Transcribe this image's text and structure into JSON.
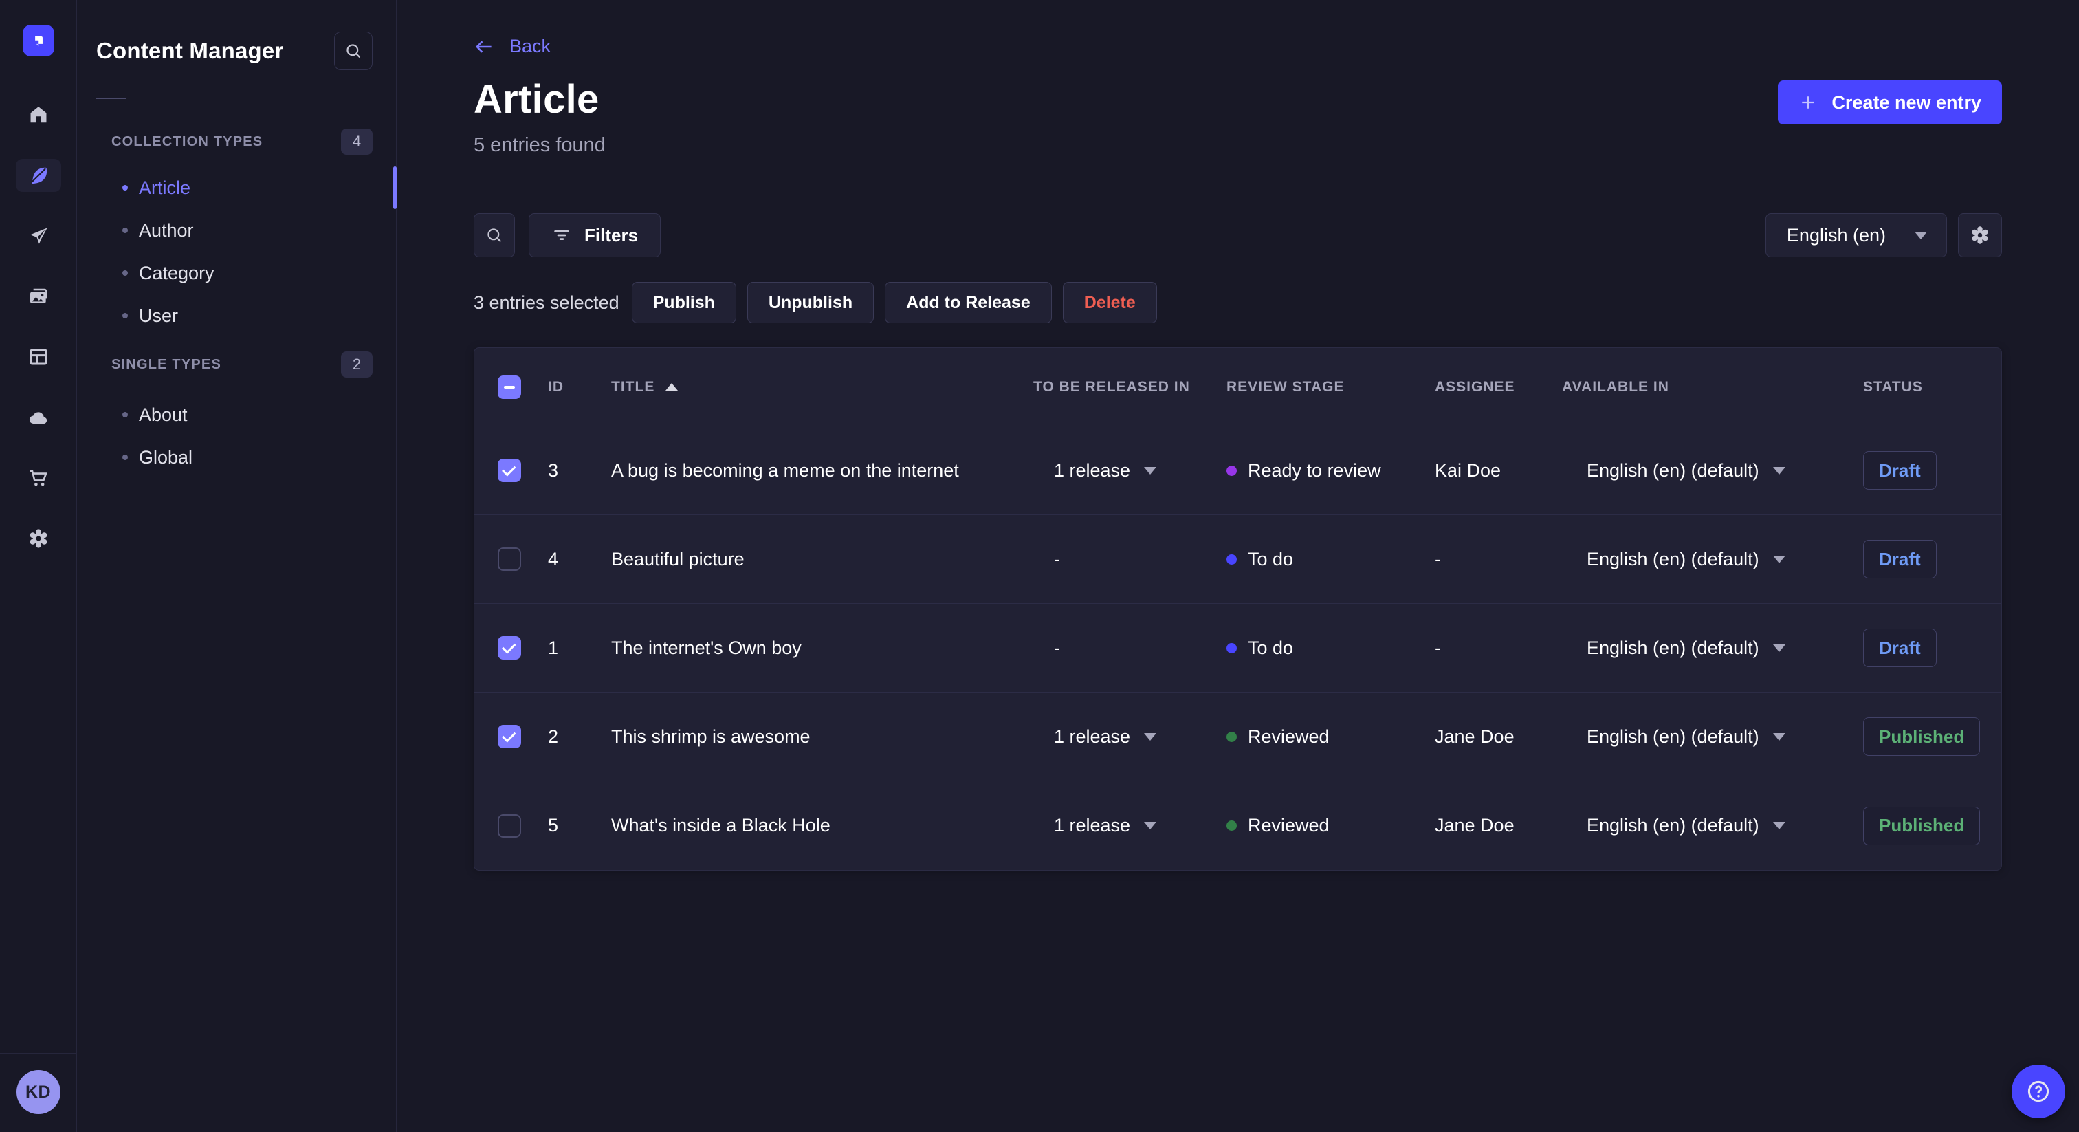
{
  "colors": {
    "brand": "#4945ff",
    "accent": "#7b79ff",
    "danger": "#ee5e52",
    "success": "#5cb176",
    "draft_blue": "#6f9bf5"
  },
  "rail": {
    "logo_icon": "strapi-logo",
    "items": [
      {
        "icon": "home-icon",
        "active": false
      },
      {
        "icon": "feather-icon",
        "active": true
      },
      {
        "icon": "paper-plane-icon",
        "active": false
      },
      {
        "icon": "media-library-icon",
        "active": false
      },
      {
        "icon": "layout-icon",
        "active": false
      },
      {
        "icon": "cloud-icon",
        "active": false
      },
      {
        "icon": "cart-icon",
        "active": false
      },
      {
        "icon": "gear-icon",
        "active": false
      }
    ],
    "avatar_initials": "KD"
  },
  "sidebar": {
    "title": "Content Manager",
    "search_icon": "search-icon",
    "sections": [
      {
        "label": "COLLECTION TYPES",
        "count": "4",
        "items": [
          {
            "label": "Article",
            "active": true
          },
          {
            "label": "Author",
            "active": false
          },
          {
            "label": "Category",
            "active": false
          },
          {
            "label": "User",
            "active": false
          }
        ]
      },
      {
        "label": "SINGLE TYPES",
        "count": "2",
        "items": [
          {
            "label": "About",
            "active": false
          },
          {
            "label": "Global",
            "active": false
          }
        ]
      }
    ]
  },
  "header": {
    "back_label": "Back",
    "title": "Article",
    "subtitle": "5 entries found",
    "create_button_label": "Create new entry"
  },
  "toolbar": {
    "filters_label": "Filters",
    "locale_value": "English (en)"
  },
  "selection": {
    "summary": "3 entries selected",
    "publish_label": "Publish",
    "unpublish_label": "Unpublish",
    "add_to_release_label": "Add to Release",
    "delete_label": "Delete"
  },
  "table": {
    "header_checkbox_indeterminate": true,
    "sort_column": "TITLE",
    "sort_direction": "asc",
    "headers": {
      "id": "ID",
      "title": "TITLE",
      "release": "TO BE RELEASED IN",
      "stage": "REVIEW STAGE",
      "assignee": "ASSIGNEE",
      "available": "AVAILABLE IN",
      "status": "STATUS"
    },
    "rows": [
      {
        "checked": true,
        "id": "3",
        "title": "A bug is becoming a meme on the internet",
        "release": "1 release",
        "has_release_menu": true,
        "stage": "Ready to review",
        "stage_color": "#9736e8",
        "assignee": "Kai Doe",
        "locale": "English (en) (default)",
        "status": "Draft",
        "status_color": "#6f9bf5"
      },
      {
        "checked": false,
        "id": "4",
        "title": "Beautiful picture",
        "release": "-",
        "has_release_menu": false,
        "stage": "To do",
        "stage_color": "#4945ff",
        "assignee": "-",
        "locale": "English (en) (default)",
        "status": "Draft",
        "status_color": "#6f9bf5"
      },
      {
        "checked": true,
        "id": "1",
        "title": "The internet's Own boy",
        "release": "-",
        "has_release_menu": false,
        "stage": "To do",
        "stage_color": "#4945ff",
        "assignee": "-",
        "locale": "English (en) (default)",
        "status": "Draft",
        "status_color": "#6f9bf5"
      },
      {
        "checked": true,
        "id": "2",
        "title": "This shrimp is awesome",
        "release": "1 release",
        "has_release_menu": true,
        "stage": "Reviewed",
        "stage_color": "#328048",
        "assignee": "Jane Doe",
        "locale": "English (en) (default)",
        "status": "Published",
        "status_color": "#5cb176"
      },
      {
        "checked": false,
        "id": "5",
        "title": "What's inside a Black Hole",
        "release": "1 release",
        "has_release_menu": true,
        "stage": "Reviewed",
        "stage_color": "#328048",
        "assignee": "Jane Doe",
        "locale": "English (en) (default)",
        "status": "Published",
        "status_color": "#5cb176"
      }
    ]
  }
}
